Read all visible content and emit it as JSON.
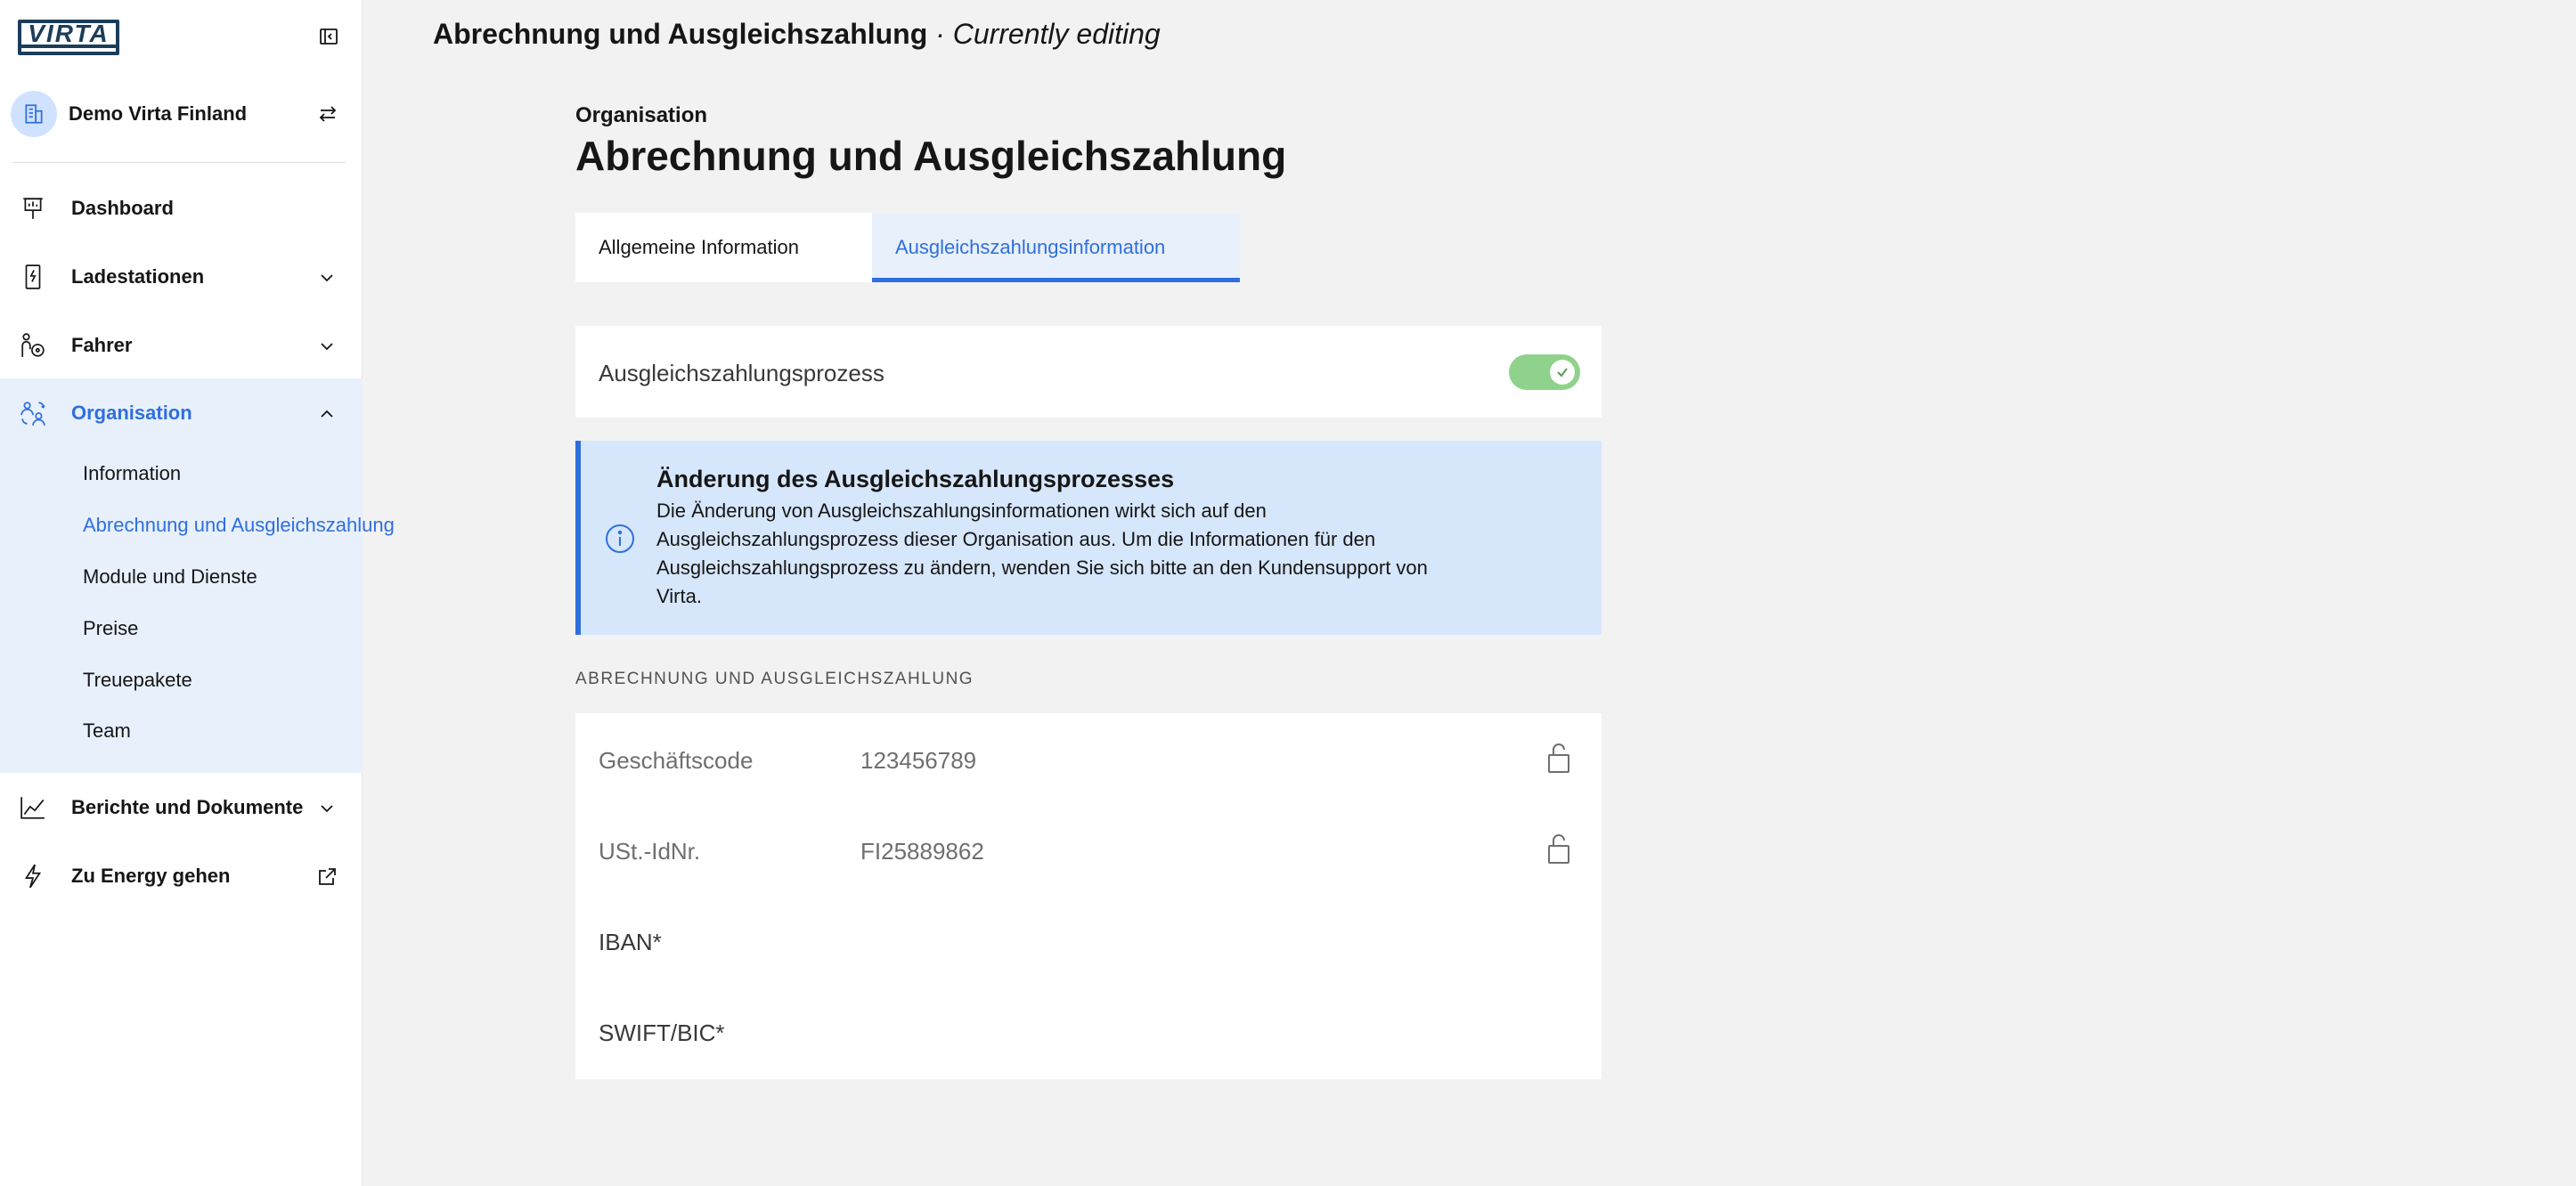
{
  "brand": {
    "logo_text": "VIRTA"
  },
  "sidebar": {
    "organization_name": "Demo Virta Finland",
    "nav": [
      {
        "label": "Dashboard"
      },
      {
        "label": "Ladestationen"
      },
      {
        "label": "Fahrer"
      },
      {
        "label": "Organisation"
      },
      {
        "label": "Berichte und Dokumente"
      },
      {
        "label": "Zu Energy gehen"
      }
    ],
    "organisation_submenu": [
      {
        "label": "Information"
      },
      {
        "label": "Abrechnung und Ausgleichszahlung"
      },
      {
        "label": "Module und Dienste"
      },
      {
        "label": "Preise"
      },
      {
        "label": "Treuepakete"
      },
      {
        "label": "Team"
      }
    ]
  },
  "header": {
    "title": "Abrechnung und Ausgleichszahlung",
    "editing_state": "· Currently editing"
  },
  "main": {
    "breadcrumb": "Organisation",
    "page_title": "Abrechnung und Ausgleichszahlung",
    "tabs": [
      {
        "label": "Allgemeine Information",
        "active": false
      },
      {
        "label": "Ausgleichszahlungsinformation",
        "active": true
      }
    ],
    "toggle": {
      "label": "Ausgleichszahlungsprozess",
      "enabled": true
    },
    "notice": {
      "title": "Änderung des Ausgleichszahlungsprozesses",
      "body": "Die Änderung von Ausgleichszahlungsinformationen wirkt sich auf den Ausgleichszahlungsprozess dieser Organisation aus. Um die Informationen für den Ausgleichszahlungsprozess zu ändern, wenden Sie sich bitte an den Kundensupport von Virta."
    },
    "section_label": "ABRECHNUNG UND AUSGLEICHSZAHLUNG",
    "fields": [
      {
        "label": "Geschäftscode",
        "value": "123456789",
        "locked": true
      },
      {
        "label": "USt.-IdNr.",
        "value": "FI25889862",
        "locked": true
      },
      {
        "label": "IBAN*",
        "value": "",
        "locked": false
      },
      {
        "label": "SWIFT/BIC*",
        "value": "",
        "locked": false
      }
    ]
  },
  "colors": {
    "accent": "#2f6fdd",
    "toggle_on": "#8fd28b",
    "notice_bg": "#d6e6fb",
    "submenu_bg": "#e8f0fc",
    "logo": "#1c3d5a"
  },
  "icons": {
    "collapse": "sidebar-collapse-icon",
    "org": "building-icon",
    "swap": "swap-arrows-icon",
    "dashboard": "presentation-board-icon",
    "stations": "charging-station-icon",
    "drivers": "driver-icon",
    "organisation": "people-settings-icon",
    "reports": "line-chart-icon",
    "energy": "lightning-icon",
    "external": "external-link-icon",
    "info": "info-icon",
    "lock": "lock-icon"
  }
}
